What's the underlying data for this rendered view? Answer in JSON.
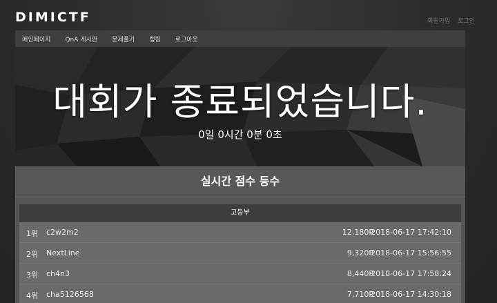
{
  "site": {
    "logo": "DIMICTF",
    "top_links": [
      "회원가입",
      "로그인"
    ]
  },
  "nav": {
    "items": [
      "메인페이지",
      "QnA 게시판",
      "문제풀기",
      "랭킹",
      "로그아웃"
    ]
  },
  "hero": {
    "title": "대회가 종료되었습니다.",
    "countdown": "0일 0시간 0분 0초"
  },
  "scoreboard": {
    "title": "실시간 점수 등수",
    "division": "고등부",
    "rows": [
      {
        "rank": "1위",
        "name": "c2w2m2",
        "score": "12,180P",
        "time": "2018-06-17 17:42:10"
      },
      {
        "rank": "2위",
        "name": "NextLine",
        "score": "9,320P",
        "time": "2018-06-17 15:56:55"
      },
      {
        "rank": "3위",
        "name": "ch4n3",
        "score": "8,440P",
        "time": "2018-06-17 17:58:24"
      },
      {
        "rank": "4위",
        "name": "cha5126568",
        "score": "7,710P",
        "time": "2018-06-17 14:30:18"
      }
    ]
  }
}
